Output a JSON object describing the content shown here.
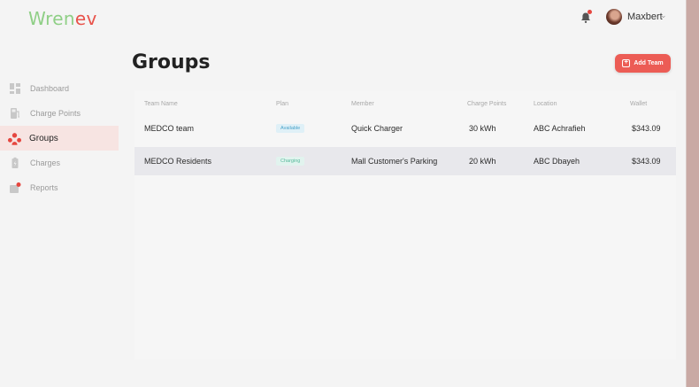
{
  "app": {
    "logo_part1": "Wren",
    "logo_part2": "ev"
  },
  "user": {
    "name": "Maxbert"
  },
  "sidebar": {
    "items": [
      {
        "label": "Dashboard",
        "icon": "dashboard-icon"
      },
      {
        "label": "Charge Points",
        "icon": "charge-point-icon"
      },
      {
        "label": "Groups",
        "icon": "groups-icon",
        "active": true
      },
      {
        "label": "Charges",
        "icon": "charges-icon"
      },
      {
        "label": "Reports",
        "icon": "reports-icon"
      }
    ]
  },
  "page": {
    "title": "Groups",
    "add_button": "Add Team"
  },
  "table": {
    "headers": [
      "Team Name",
      "Plan",
      "Member",
      "Charge Points",
      "Location",
      "Wallet"
    ],
    "rows": [
      {
        "team": "MEDCO team",
        "plan": "Available",
        "member": "Quick Charger",
        "charge_points": "30 kWh",
        "location": "ABC Achrafieh",
        "wallet": "$343.09"
      },
      {
        "team": "MEDCO Residents",
        "plan": "Charging",
        "member": "Mall Customer's Parking",
        "charge_points": "20 kWh",
        "location": "ABC Dbayeh",
        "wallet": "$343.09"
      }
    ]
  },
  "colors": {
    "accent": "#ec5c55",
    "logo_green": "#8fcf86",
    "active_nav_bg": "#f7e4e2"
  }
}
